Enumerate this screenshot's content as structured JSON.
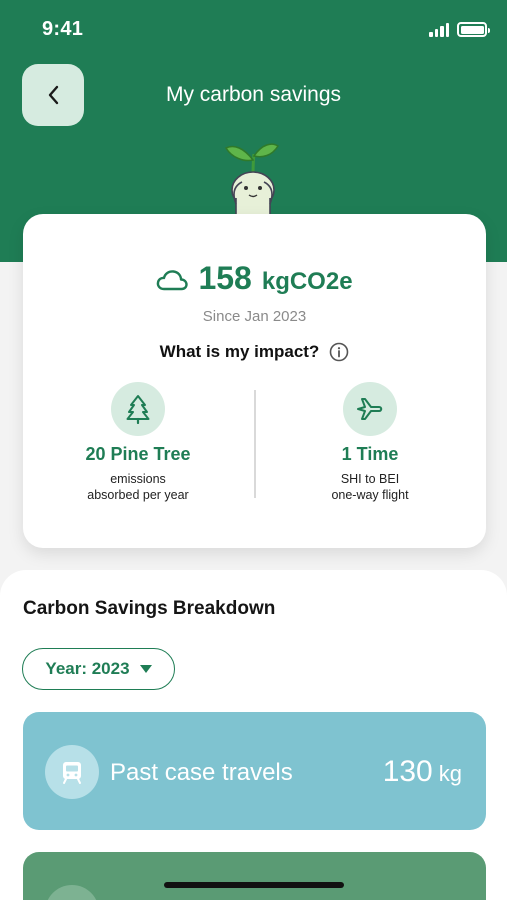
{
  "status_bar": {
    "time": "9:41"
  },
  "header": {
    "title": "My carbon savings",
    "back_icon": "chevron-left-icon"
  },
  "impact": {
    "total_value": "158",
    "total_unit": "kgCO2e",
    "since": "Since Jan 2023",
    "question": "What is my impact?",
    "metrics": [
      {
        "icon": "pine-tree-icon",
        "value": "20 Pine Tree",
        "desc_line1": "emissions",
        "desc_line2": "absorbed per year"
      },
      {
        "icon": "airplane-icon",
        "value": "1 Time",
        "desc_line1": "SHI to BEI",
        "desc_line2": "one-way flight"
      }
    ]
  },
  "breakdown": {
    "title": "Carbon Savings Breakdown",
    "year_filter": "Year: 2023",
    "items": [
      {
        "icon": "train-icon",
        "label": "Past case travels",
        "value": "130",
        "unit": "kg",
        "color": "#7fc3d0"
      }
    ]
  },
  "colors": {
    "primary": "#1f7d55",
    "accent_light": "#d6ebe0",
    "travel_card": "#7fc3d0"
  }
}
